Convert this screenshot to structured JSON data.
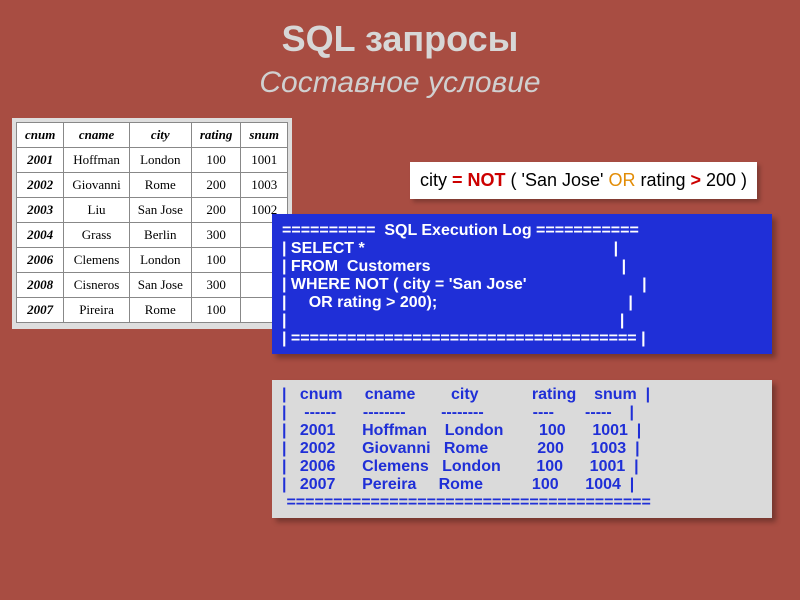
{
  "title": "SQL запросы",
  "subtitle": "Составное условие",
  "table": {
    "headers": [
      "cnum",
      "cname",
      "city",
      "rating",
      "snum"
    ],
    "rows": [
      [
        "2001",
        "Hoffman",
        "London",
        "100",
        "1001"
      ],
      [
        "2002",
        "Giovanni",
        "Rome",
        "200",
        "1003"
      ],
      [
        "2003",
        "Liu",
        "San Jose",
        "200",
        "1002"
      ],
      [
        "2004",
        "Grass",
        "Berlin",
        "300",
        ""
      ],
      [
        "2006",
        "Clemens",
        "London",
        "100",
        ""
      ],
      [
        "2008",
        "Cisneros",
        "San Jose",
        "300",
        ""
      ],
      [
        "2007",
        "Pireira",
        "Rome",
        "100",
        ""
      ]
    ]
  },
  "expression": {
    "p1": "city ",
    "eq": "= ",
    "not": "NOT",
    "p2": " ( 'San Jose' ",
    "or": "OR",
    "p3": " rating ",
    "gt": ">",
    "p4": " 200 )"
  },
  "log": {
    "l1": "==========  SQL Execution Log ===========",
    "l2": "| SELECT *                                                        |",
    "l3": "| FROM  Customers                                           |",
    "l4": "| WHERE NOT ( city = 'San Jose'                          |",
    "l5": "|     OR rating > 200);                                           |",
    "l6": "|                                                                           |",
    "l7": "| ===================================== |"
  },
  "result": {
    "r1": "|   cnum     cname        city            rating    snum  |",
    "r2": "|    ------      --------        --------           ----       -----    |",
    "r3": "|   2001      Hoffman    London        100      1001  |",
    "r4": "|   2002      Giovanni   Rome           200      1003  |",
    "r5": "|   2006      Clemens   London        100      1001  |",
    "r6": "|   2007      Pereira     Rome           100      1004  |",
    "r7": " ======================================="
  }
}
